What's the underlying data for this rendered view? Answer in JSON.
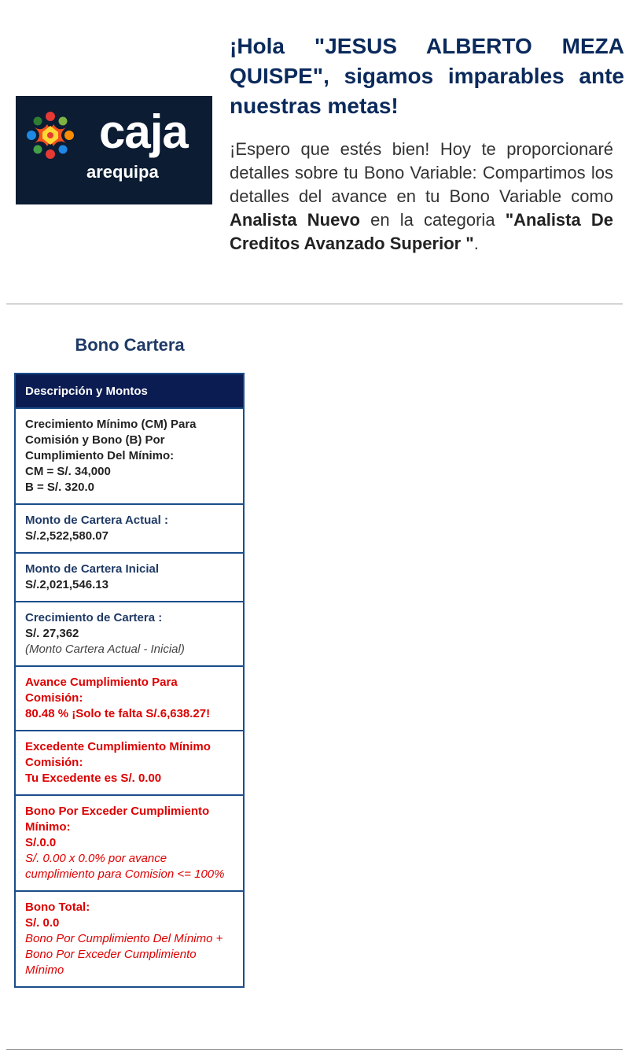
{
  "brand": {
    "logo_word": "caja",
    "logo_sub": "arequipa",
    "logo_icon": "caja-arequipa-star-icon",
    "colors": {
      "bg": "#0b1c33",
      "title": "#0b2a5c",
      "alert": "#dd0000",
      "table_border": "#1a4d8a",
      "table_header": "#0b1c52"
    }
  },
  "greeting": "¡Hola \"JESUS ALBERTO MEZA QUISPE\", sigamos imparables ante nuestras metas!",
  "intro": {
    "p1": "¡Espero que estés bien! Hoy te proporcionaré detalles sobre tu Bono Variable: Compartimos los detalles del avance en tu Bono Variable como ",
    "role": "Analista Nuevo",
    "p2": " en la categoria ",
    "category": "\"Analista De Creditos Avanzado Superior \"",
    "p3": "."
  },
  "section": {
    "title": "Bono Cartera",
    "header": "Descripción y Montos",
    "rows": {
      "cm": {
        "label": "Crecimiento Mínimo (CM) Para Comisión y Bono (B) Por Cumplimiento Del Mínimo:",
        "cm_value": "CM = S/. 34,000",
        "b_value": "B = S/. 320.0"
      },
      "actual": {
        "label": "Monto de Cartera Actual :",
        "value": "S/.2,522,580.07"
      },
      "inicial": {
        "label": "Monto de Cartera Inicial",
        "value": "S/.2,021,546.13"
      },
      "crecimiento": {
        "label": "Crecimiento de Cartera :",
        "value": "S/. 27,362",
        "note": "(Monto Cartera Actual - Inicial)"
      },
      "avance": {
        "label": "Avance Cumplimiento Para Comisión:",
        "value": "80.48 % ¡Solo te falta S/.6,638.27!"
      },
      "excedente": {
        "label": "Excedente Cumplimiento Mínimo Comisión:",
        "value": "Tu Excedente es S/. 0.00"
      },
      "bono_exceder": {
        "label": "Bono Por Exceder Cumplimiento Mínimo:",
        "value": "S/.0.0",
        "note": "S/. 0.00 x 0.0% por avance cumplimiento para Comision <= 100%"
      },
      "bono_total": {
        "label": "Bono Total:",
        "value": "S/. 0.0",
        "note": "Bono Por Cumplimiento Del Mínimo + Bono Por Exceder Cumplimiento Mínimo"
      }
    }
  }
}
